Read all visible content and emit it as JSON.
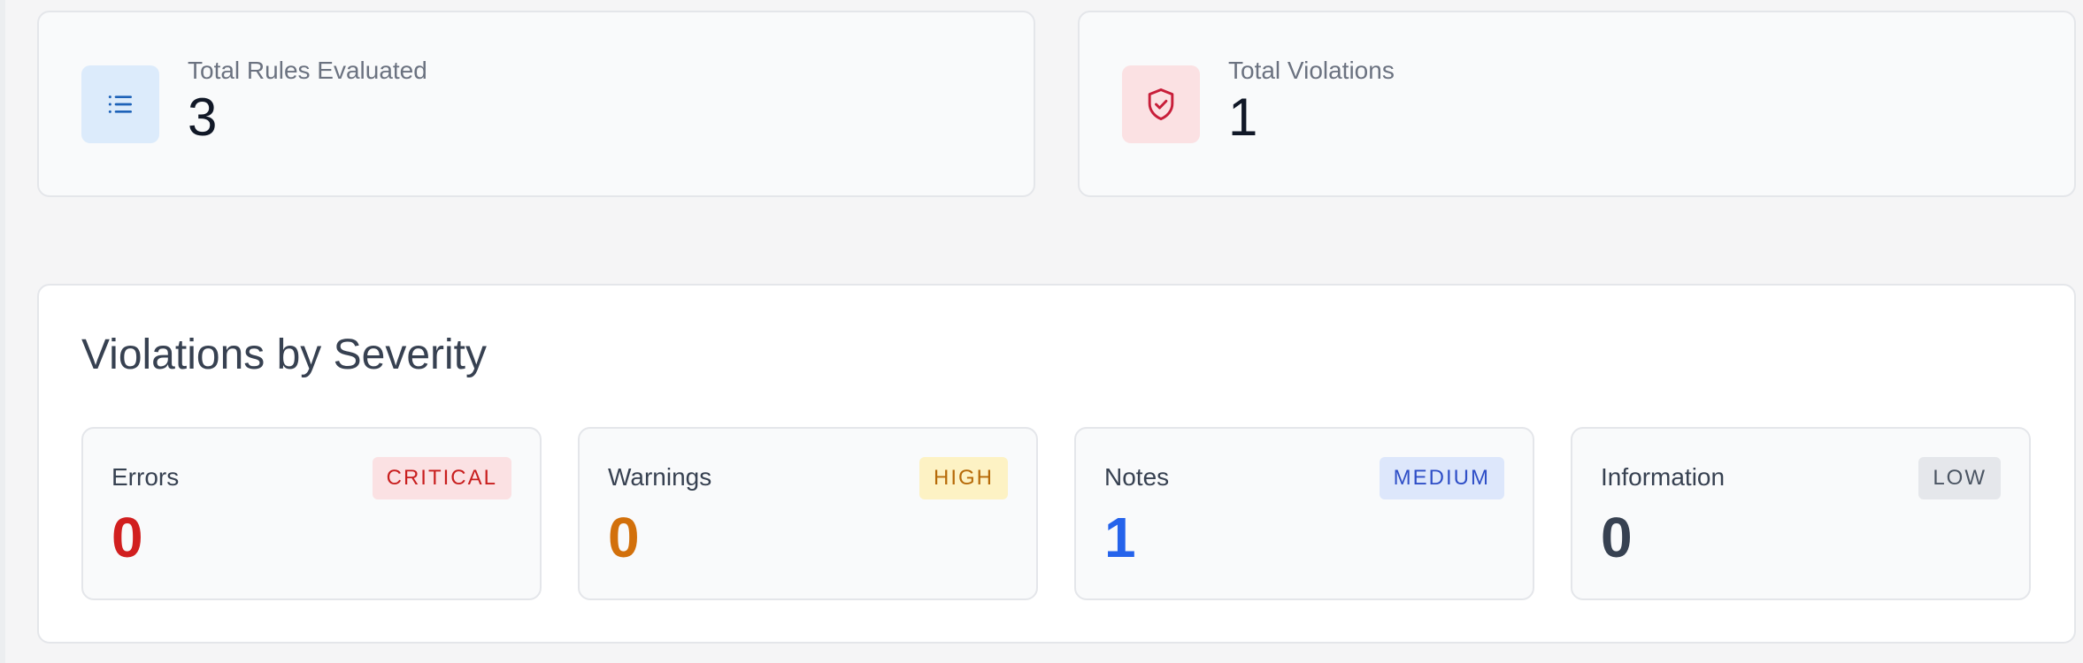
{
  "stats": {
    "rules": {
      "label": "Total Rules Evaluated",
      "value": "3",
      "icon": "list-icon",
      "icon_color": "#1d62b8"
    },
    "violations": {
      "label": "Total Violations",
      "value": "1",
      "icon": "shield-check-icon",
      "icon_color": "#c81e3a"
    }
  },
  "severity": {
    "title": "Violations by Severity",
    "cards": [
      {
        "label": "Errors",
        "badge": "CRITICAL",
        "value": "0",
        "color": "#d11f1f"
      },
      {
        "label": "Warnings",
        "badge": "HIGH",
        "value": "0",
        "color": "#d2700b"
      },
      {
        "label": "Notes",
        "badge": "MEDIUM",
        "value": "1",
        "color": "#2563eb"
      },
      {
        "label": "Information",
        "badge": "LOW",
        "value": "0",
        "color": "#374151"
      }
    ]
  }
}
